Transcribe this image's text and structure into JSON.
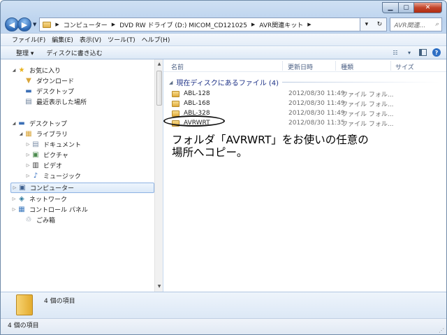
{
  "window": {
    "min_glyph": "▁",
    "max_glyph": "▢",
    "close_glyph": "✕"
  },
  "address": {
    "crumbs": [
      "コンピューター",
      "DVD RW ドライブ (D:) MICOM_CD121025",
      "AVR関連キット"
    ],
    "search_placeholder": "AVR関連..."
  },
  "menu": [
    "ファイル(F)",
    "編集(E)",
    "表示(V)",
    "ツール(T)",
    "ヘルプ(H)"
  ],
  "commands": {
    "organize": "整理 ▾",
    "burn": "ディスクに書き込む"
  },
  "nav": {
    "favorites": "お気に入り",
    "downloads": "ダウンロード",
    "desktop_fav": "デスクトップ",
    "recent": "最近表示した場所",
    "desktop": "デスクトップ",
    "libraries": "ライブラリ",
    "documents": "ドキュメント",
    "pictures": "ピクチャ",
    "videos": "ビデオ",
    "music": "ミュージック",
    "computer": "コンピューター",
    "network": "ネットワーク",
    "control_panel": "コントロール パネル",
    "recycle": "ごみ箱"
  },
  "columns": {
    "name": "名前",
    "date": "更新日時",
    "type": "種類",
    "size": "サイズ"
  },
  "group_header": "現在ディスクにあるファイル (4)",
  "files": [
    {
      "name": "ABL-128",
      "date": "2012/08/30 11:49",
      "type": "ファイル フォル..."
    },
    {
      "name": "ABL-168",
      "date": "2012/08/30 11:49",
      "type": "ファイル フォル..."
    },
    {
      "name": "ABL-328",
      "date": "2012/08/30 11:49",
      "type": "ファイル フォル..."
    },
    {
      "name": "AVRWRT",
      "date": "2012/08/30 11:35",
      "type": "ファイル フォル..."
    }
  ],
  "annotation": {
    "line1": "フォルダ「AVRWRT」をお使いの任意の",
    "line2": "場所へコピー。"
  },
  "details": {
    "count": "4 個の項目"
  },
  "status": {
    "count": "4 個の項目"
  },
  "colors": {
    "header_text": "#1e3287",
    "selection_border": "#8db2e3"
  }
}
